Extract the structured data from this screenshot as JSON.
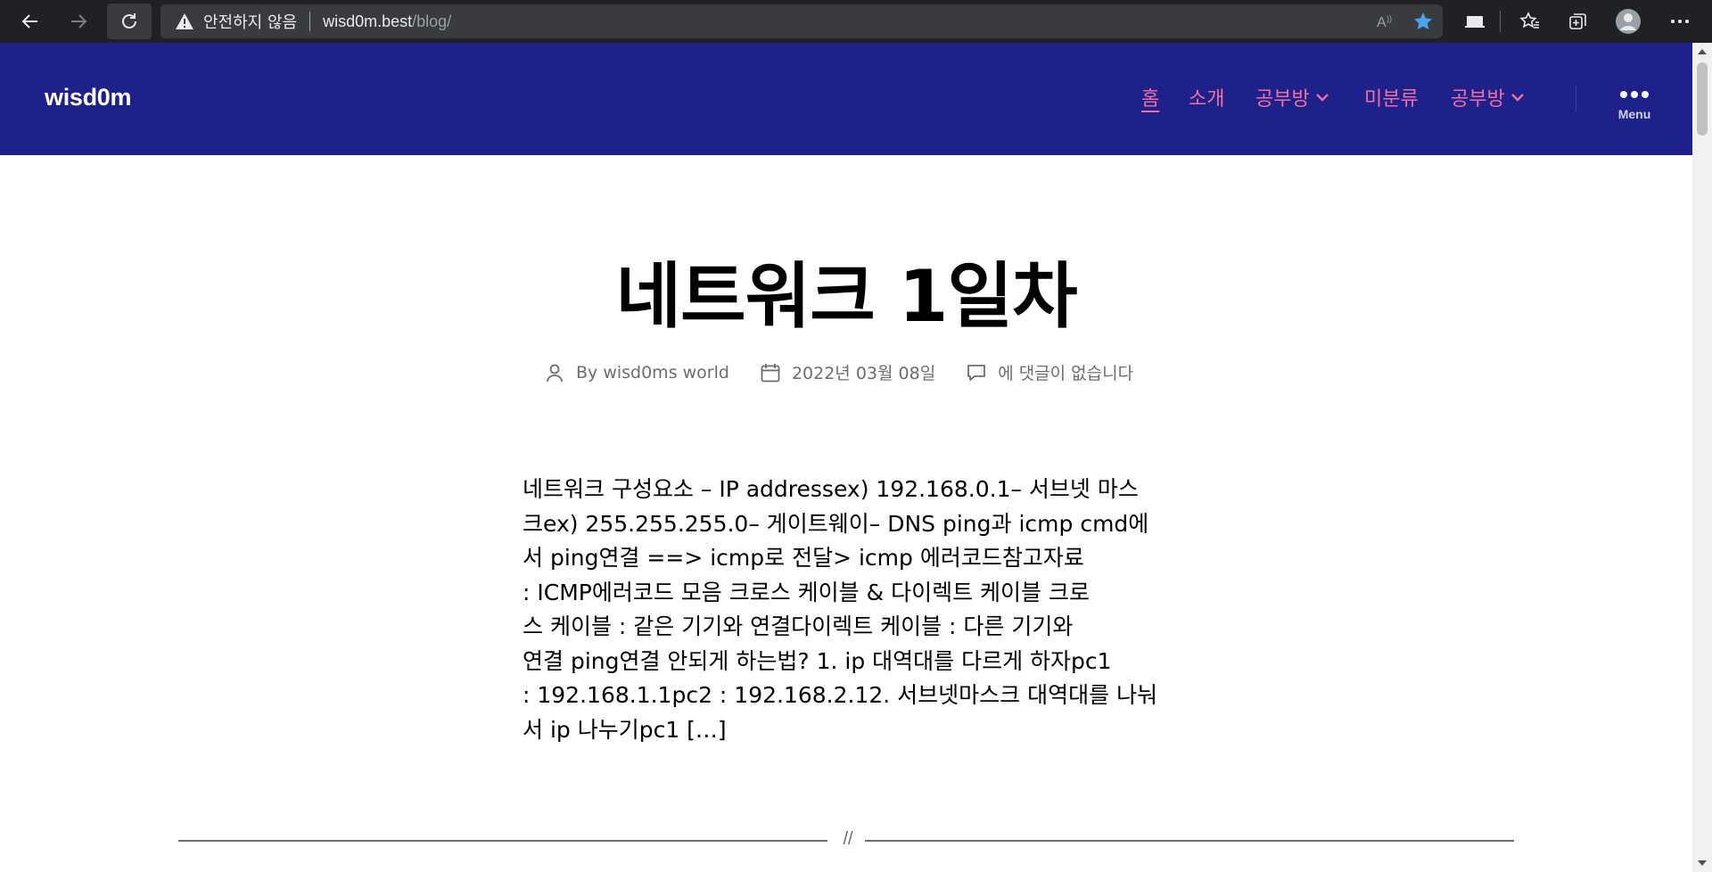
{
  "browser": {
    "security_warning": "안전하지 않음",
    "url_host": "wisd0m.best",
    "url_path": "/blog/",
    "icons": [
      "back-icon",
      "forward-icon",
      "reload-icon",
      "warning-icon",
      "read-aloud-icon",
      "favorite-star-icon",
      "sidebar-icon",
      "favorites-icon",
      "collections-icon",
      "profile-icon",
      "more-icon"
    ],
    "colors": {
      "chrome_bg": "#202124",
      "star": "#4aa3f0"
    }
  },
  "site": {
    "title": "wisd0m",
    "header_bg": "#1f218b",
    "menu_color": "#f06ea3",
    "menu": [
      {
        "label": "홈",
        "current": true,
        "has_sub": false
      },
      {
        "label": "소개",
        "current": false,
        "has_sub": false
      },
      {
        "label": "공부방",
        "current": false,
        "has_sub": true
      },
      {
        "label": "미분류",
        "current": false,
        "has_sub": false
      },
      {
        "label": "공부방",
        "current": false,
        "has_sub": true
      }
    ],
    "menu_toggle_label": "Menu"
  },
  "post": {
    "title": "네트워크 1일차",
    "author": "By wisd0ms world",
    "date": "2022년 03월 08일",
    "comments": "에 댓글이 없습니다",
    "excerpt_lines": [
      "네트워크 구성요소 – IP addressex) 192.168.0.1– 서브넷 마스",
      "크ex) 255.255.255.0– 게이트웨이– DNS ping과 icmp cmd에",
      "서 ping연결 ==> icmp로 전달> icmp 에러코드참고자료",
      ": ICMP에러코드 모음 크로스 케이블 & 다이렉트 케이블 크로",
      "스 케이블 : 같은 기기와 연결다이렉트 케이블 : 다른 기기와",
      "연결 ping연결 안되게 하는법? 1. ip 대역대를 다르게 하자pc1",
      ": 192.168.1.1pc2 : 192.168.2.12. 서브넷마스크 대역대를 나눠",
      "서 ip 나누기pc1 […]"
    ],
    "separator": "//"
  }
}
